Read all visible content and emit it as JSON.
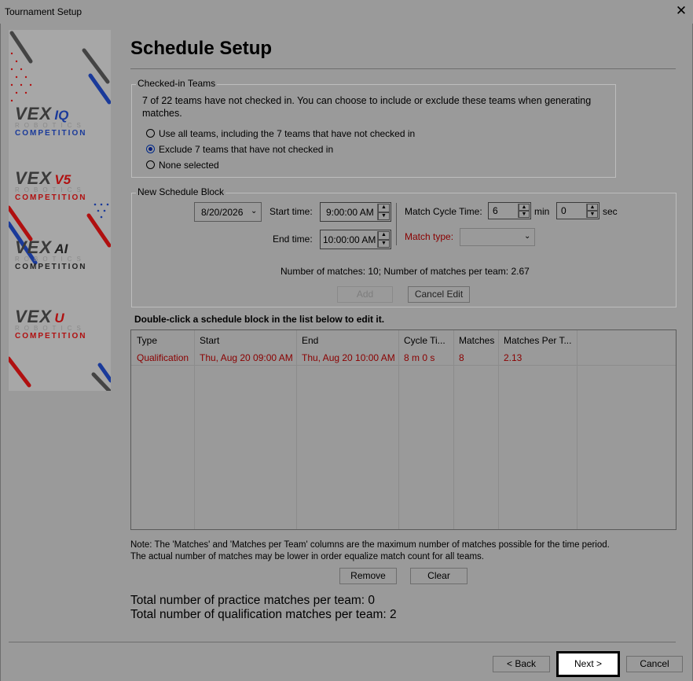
{
  "window": {
    "title": "Tournament Setup",
    "close_glyph": "✕"
  },
  "banner": {
    "logos": [
      {
        "brand": "VEX",
        "suffix": "IQ",
        "suffix_color": "#1a3a9a",
        "line1": "ROBOTICS",
        "line2": "COMPETITION",
        "line2_color": "#1a3a9a"
      },
      {
        "brand": "VEX",
        "suffix": "V5",
        "suffix_color": "#b01010",
        "line1": "ROBOTICS",
        "line2": "COMPETITION",
        "line2_color": "#b01010"
      },
      {
        "brand": "VEX",
        "suffix": "AI",
        "suffix_color": "#222222",
        "line1": "ROBOTICS",
        "line2": "COMPETITION",
        "line2_color": "#222222"
      },
      {
        "brand": "VEX",
        "suffix": "U",
        "suffix_color": "#b01010",
        "line1": "ROBOTICS",
        "line2": "COMPETITION",
        "line2_color": "#b01010"
      }
    ]
  },
  "page_title": "Schedule Setup",
  "checked_in": {
    "title": "Checked-in Teams",
    "description": "7 of 22 teams have not checked in. You can choose to include or exclude these teams when generating matches.",
    "options": [
      {
        "label": "Use all teams, including the 7 teams that have not checked in",
        "selected": false
      },
      {
        "label": "Exclude 7 teams that have not checked in",
        "selected": true
      },
      {
        "label": "None selected",
        "selected": false
      }
    ]
  },
  "schedule_block": {
    "title": "New Schedule Block",
    "date": "8/20/2026",
    "start_label": "Start time:",
    "start_value": "9:00:00 AM",
    "end_label": "End time:",
    "end_value": "10:00:00 AM",
    "cycle_label": "Match Cycle Time:",
    "cycle_min": "6",
    "min_unit": "min",
    "cycle_sec": "0",
    "sec_unit": "sec",
    "match_type_label": "Match type:",
    "match_type_value": "",
    "summary": "Number of matches: 10; Number of matches per team: 2.67",
    "add_label": "Add",
    "cancel_edit_label": "Cancel Edit"
  },
  "list_hint": "Double-click a schedule block in the list below to edit it.",
  "table": {
    "columns": [
      "Type",
      "Start",
      "End",
      "Cycle Ti...",
      "Matches",
      "Matches Per T..."
    ],
    "rows": [
      [
        "Qualification",
        "Thu, Aug 20 09:00 AM",
        "Thu, Aug 20 10:00 AM",
        "8 m 0 s",
        "8",
        "2.13"
      ]
    ],
    "row_color": "#8a0000"
  },
  "note": "Note: The 'Matches' and 'Matches per Team' columns are the maximum number of matches possible for the time period.  The actual number of matches may be lower in order equalize match count for all teams.",
  "remove_label": "Remove",
  "clear_label": "Clear",
  "totals": {
    "practice": "Total number of practice matches per team: 0",
    "qualification": "Total number of qualification matches per team: 2"
  },
  "footer": {
    "back_label": "< Back",
    "next_label": "Next >",
    "cancel_label": "Cancel"
  }
}
